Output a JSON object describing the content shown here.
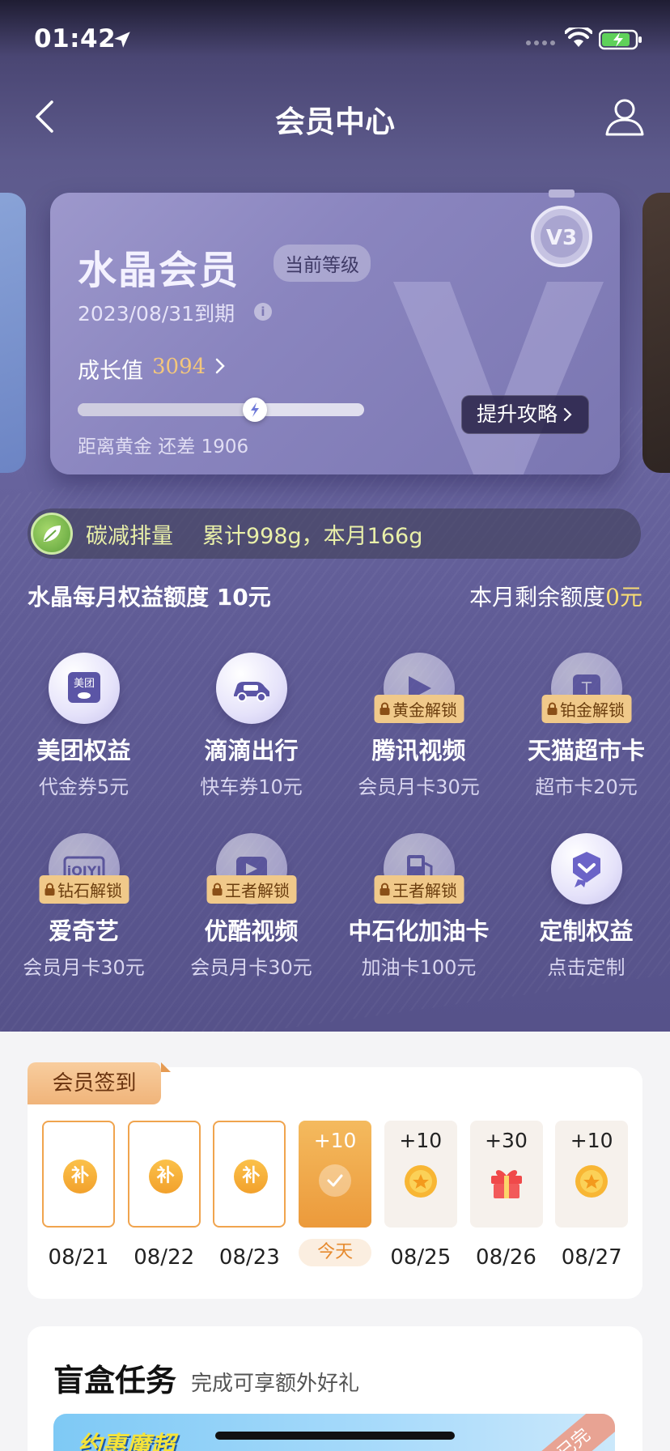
{
  "status_bar": {
    "time": "01:42"
  },
  "nav": {
    "title": "会员中心"
  },
  "card": {
    "level_name": "水晶会员",
    "level_badge": "当前等级",
    "expiry": "2023/08/31到期",
    "growth_label": "成长值",
    "growth_value": "3094",
    "progress_fraction": 0.62,
    "gap_text": "距离黄金 还差 1906",
    "upgrade_button": "提升攻略",
    "medal_label": "V3"
  },
  "carbon": {
    "label": "碳减排量",
    "value": "累计998g，本月166g"
  },
  "quota": {
    "left": "水晶每月权益额度 10元",
    "right_prefix": "本月剩余额度",
    "right_value": "0元"
  },
  "benefits": [
    {
      "title": "美团权益",
      "sub": "代金券5元",
      "icon": "meituan-icon",
      "lock": ""
    },
    {
      "title": "滴滴出行",
      "sub": "快车券10元",
      "icon": "car-icon",
      "lock": ""
    },
    {
      "title": "腾讯视频",
      "sub": "会员月卡30元",
      "icon": "tencent-video-icon",
      "lock": "黄金解锁"
    },
    {
      "title": "天猫超市卡",
      "sub": "超市卡20元",
      "icon": "tmall-icon",
      "lock": "铂金解锁"
    },
    {
      "title": "爱奇艺",
      "sub": "会员月卡30元",
      "icon": "iqiyi-icon",
      "lock": "钻石解锁"
    },
    {
      "title": "优酷视频",
      "sub": "会员月卡30元",
      "icon": "youku-icon",
      "lock": "王者解锁"
    },
    {
      "title": "中石化加油卡",
      "sub": "加油卡100元",
      "icon": "fuel-icon",
      "lock": "王者解锁"
    },
    {
      "title": "定制权益",
      "sub": "点击定制",
      "icon": "custom-badge-icon",
      "lock": ""
    }
  ],
  "checkin": {
    "tab": "会员签到",
    "days": [
      {
        "date": "08/21",
        "state": "missed",
        "mark": "补"
      },
      {
        "date": "08/22",
        "state": "missed",
        "mark": "补"
      },
      {
        "date": "08/23",
        "state": "missed",
        "mark": "补"
      },
      {
        "date": "今天",
        "state": "today",
        "points": "+10"
      },
      {
        "date": "08/25",
        "state": "future",
        "points": "+10",
        "reward": "coin"
      },
      {
        "date": "08/26",
        "state": "future",
        "points": "+30",
        "reward": "gift"
      },
      {
        "date": "08/27",
        "state": "future",
        "points": "+10",
        "reward": "coin"
      }
    ]
  },
  "blind_box": {
    "title": "盲盒任务",
    "subtitle": "完成可享额外好礼",
    "banner_text": "约惠魔超",
    "ribbon": "已完"
  },
  "colors": {
    "accent_gold": "#f7dc74",
    "checkin_orange": "#ec9a3b",
    "lock_tag": "#f0c98a"
  }
}
